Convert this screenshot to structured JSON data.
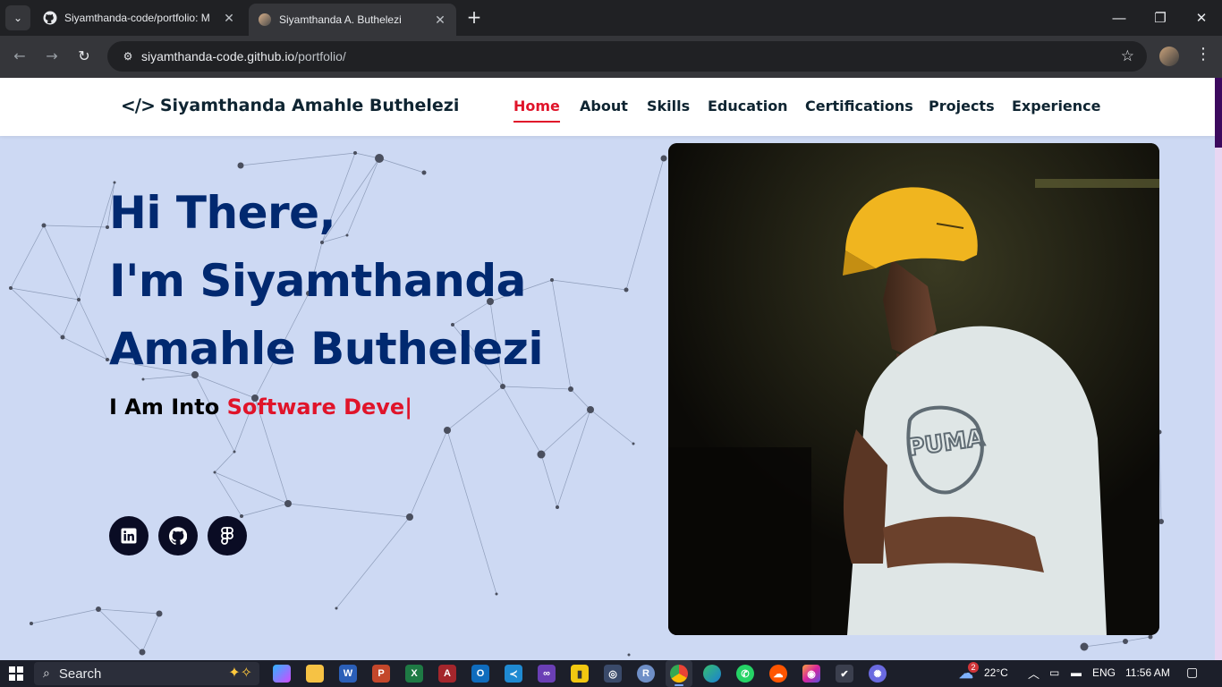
{
  "browser": {
    "tabs": [
      {
        "title": "Siyamthanda-code/portfolio: M",
        "active": false
      },
      {
        "title": "Siyamthanda A. Buthelezi",
        "active": true
      }
    ],
    "url_host": "siyamthanda-code.github.io",
    "url_path": "/portfolio/"
  },
  "site": {
    "brand": "Siyamthanda Amahle Buthelezi",
    "brand_icon": "</>",
    "nav": [
      "Home",
      "About",
      "Skills",
      "Education",
      "Certifications",
      "Projects",
      "Experience"
    ],
    "active_nav": "Home"
  },
  "hero": {
    "line1": "Hi There,",
    "line2": "I'm Siyamthanda",
    "line3": "Amahle Buthelezi",
    "typed_prefix": "I Am Into ",
    "typed_role": "Software Deve|",
    "socials": [
      "linkedin-icon",
      "github-icon",
      "figma-icon"
    ]
  },
  "colors": {
    "accent": "#e0142a",
    "heading": "#012970",
    "page_bg": "#cdd9f3"
  },
  "taskbar": {
    "search_label": "Search",
    "temperature": "22°C",
    "weather_badge": "2",
    "language": "ENG",
    "time": "11:56 AM"
  }
}
